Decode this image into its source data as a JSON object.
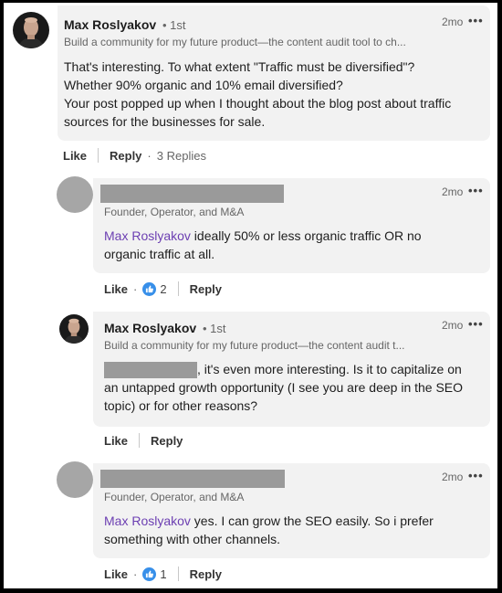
{
  "comments": [
    {
      "author": "Max Roslyakov",
      "degree": "• 1st",
      "headline": "Build a community for my future product—the content audit tool to ch...",
      "time": "2mo",
      "more": "•••",
      "lines": [
        "That's interesting. To what extent \"Traffic must be diversified\"?",
        "Whether 90% organic and 10% email diversified?",
        "Your post popped up when I thought about the blog post about traffic",
        "sources for the businesses for sale."
      ],
      "actions": {
        "like": "Like",
        "reply": "Reply",
        "replies": "3 Replies",
        "dot": "·"
      }
    },
    {
      "author": "",
      "headline": "Founder, Operator, and M&A",
      "time": "2mo",
      "more": "•••",
      "mention": "Max Roslyakov",
      "lines": [
        " ideally 50% or less organic traffic OR no",
        "organic traffic at all."
      ],
      "actions": {
        "like": "Like",
        "dot": "·",
        "reactions": "2",
        "reply": "Reply"
      }
    },
    {
      "author": "Max Roslyakov",
      "degree": "• 1st",
      "headline": "Build a community for my future product—the content audit t...",
      "time": "2mo",
      "more": "•••",
      "lines": [
        ", it's even more interesting. Is it to capitalize on",
        "an untapped growth opportunity (I see you are deep in the SEO",
        "topic) or for other reasons?"
      ],
      "actions": {
        "like": "Like",
        "reply": "Reply"
      }
    },
    {
      "author": "",
      "headline": "Founder, Operator, and M&A",
      "time": "2mo",
      "more": "•••",
      "mention": "Max Roslyakov",
      "lines": [
        " yes. I can grow the SEO easily. So i prefer",
        "something with other channels."
      ],
      "actions": {
        "like": "Like",
        "dot": "·",
        "reactions": "1",
        "reply": "Reply"
      }
    }
  ],
  "colors": {
    "mention": "#6c3fb2",
    "reaction": "#378fe9",
    "bubble": "#f2f2f2"
  },
  "icons": {
    "reaction": "thumbs-up-icon",
    "more": "more-options-icon"
  }
}
